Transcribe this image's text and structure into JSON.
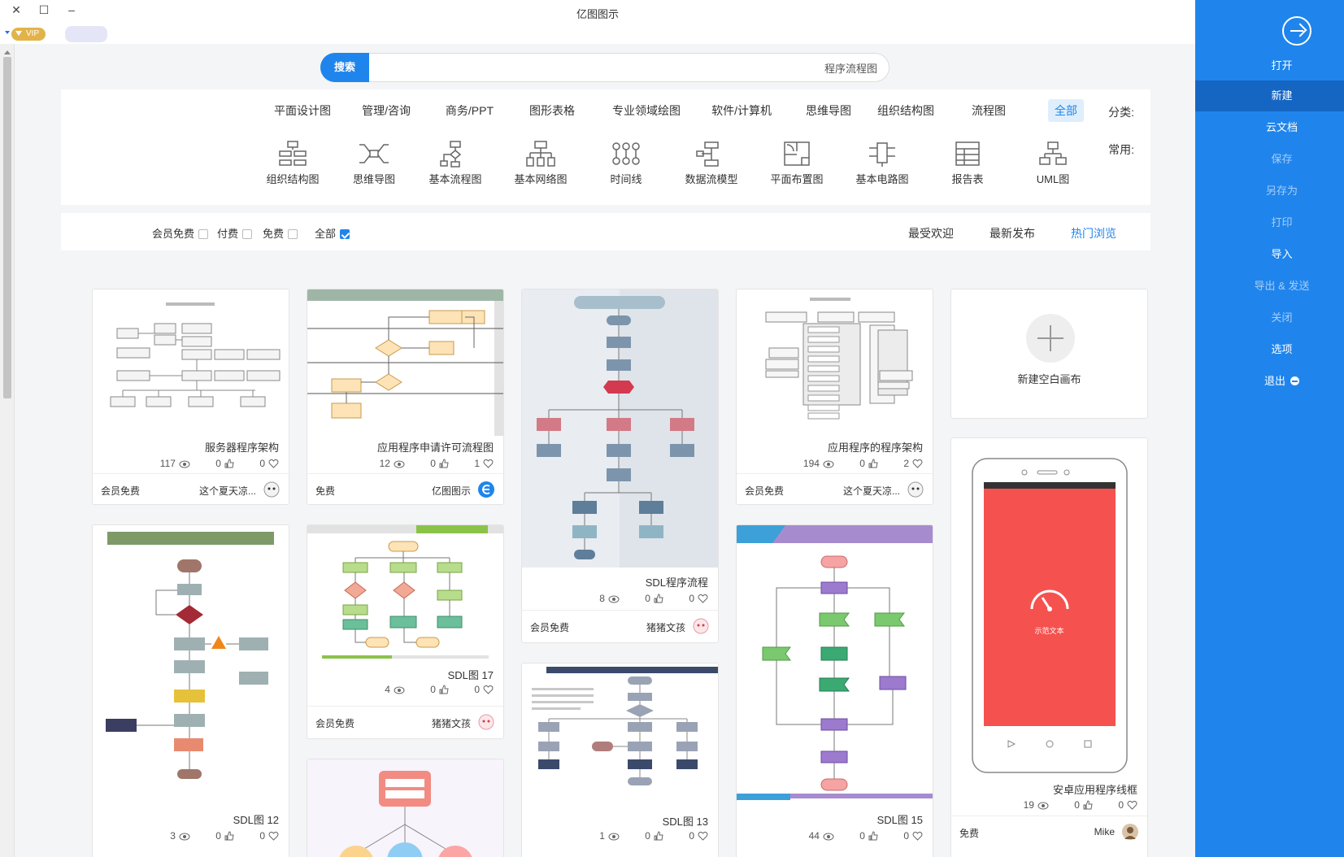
{
  "window": {
    "title": "亿图图示",
    "vip": "VIP"
  },
  "search": {
    "button": "搜索",
    "value": "程序流程图"
  },
  "categories": {
    "label": "分类:",
    "items": [
      "全部",
      "流程图",
      "组织结构图",
      "思维导图",
      "软件/计算机",
      "专业领域绘图",
      "图形表格",
      "商务/PPT",
      "管理/咨询",
      "平面设计图"
    ],
    "active": "全部"
  },
  "common": {
    "label": "常用:",
    "items": [
      "UML图",
      "报告表",
      "基本电路图",
      "平面布置图",
      "数据流模型",
      "时间线",
      "基本网络图",
      "基本流程图",
      "思维导图",
      "组织结构图"
    ]
  },
  "sort": {
    "items": [
      "热门浏览",
      "最新发布",
      "最受欢迎"
    ],
    "active": "热门浏览"
  },
  "filters": {
    "items": [
      "全部",
      "免费",
      "付费",
      "会员免费"
    ],
    "checked": "全部"
  },
  "sidebar": {
    "open": "打开",
    "items": [
      "新建",
      "云文档",
      "保存",
      "另存为",
      "打印",
      "导入",
      "导出 & 发送",
      "关闭",
      "选项",
      "退出"
    ],
    "active": "新建"
  },
  "blank_card": {
    "label": "新建空白画布"
  },
  "cards": [
    {
      "title": "服务器程序架构",
      "views": "117",
      "likes": "0",
      "favs": "0",
      "author": "这个夏天凉...",
      "price": "会员免费"
    },
    {
      "title": "应用程序申请许可流程图",
      "views": "12",
      "likes": "0",
      "favs": "1",
      "author": "亿图图示",
      "price": "免费"
    },
    {
      "title": "SDL程序流程",
      "views": "8",
      "likes": "0",
      "favs": "0",
      "author": "猪猪文孩",
      "price": "会员免费"
    },
    {
      "title": "应用程序的程序架构",
      "views": "194",
      "likes": "0",
      "favs": "2",
      "author": "这个夏天凉...",
      "price": "会员免费"
    },
    {
      "title": "SDL图 12",
      "views": "3",
      "likes": "0",
      "favs": "0"
    },
    {
      "title": "SDL图 17",
      "views": "4",
      "likes": "0",
      "favs": "0",
      "author": "猪猪文孩",
      "price": "会员免费"
    },
    {
      "title": "SDL图 13",
      "views": "1",
      "likes": "0",
      "favs": "0"
    },
    {
      "title": "SDL图 15",
      "views": "44",
      "likes": "0",
      "favs": "0"
    },
    {
      "title": "安卓应用程序线框",
      "views": "19",
      "likes": "0",
      "favs": "0",
      "author": "Mike",
      "price": "免费",
      "screen_text": "示范文本"
    }
  ],
  "colors": {
    "accent": "#1f85ec",
    "sidebar": "#1f85ec",
    "phone_screen": "#f5524f"
  }
}
